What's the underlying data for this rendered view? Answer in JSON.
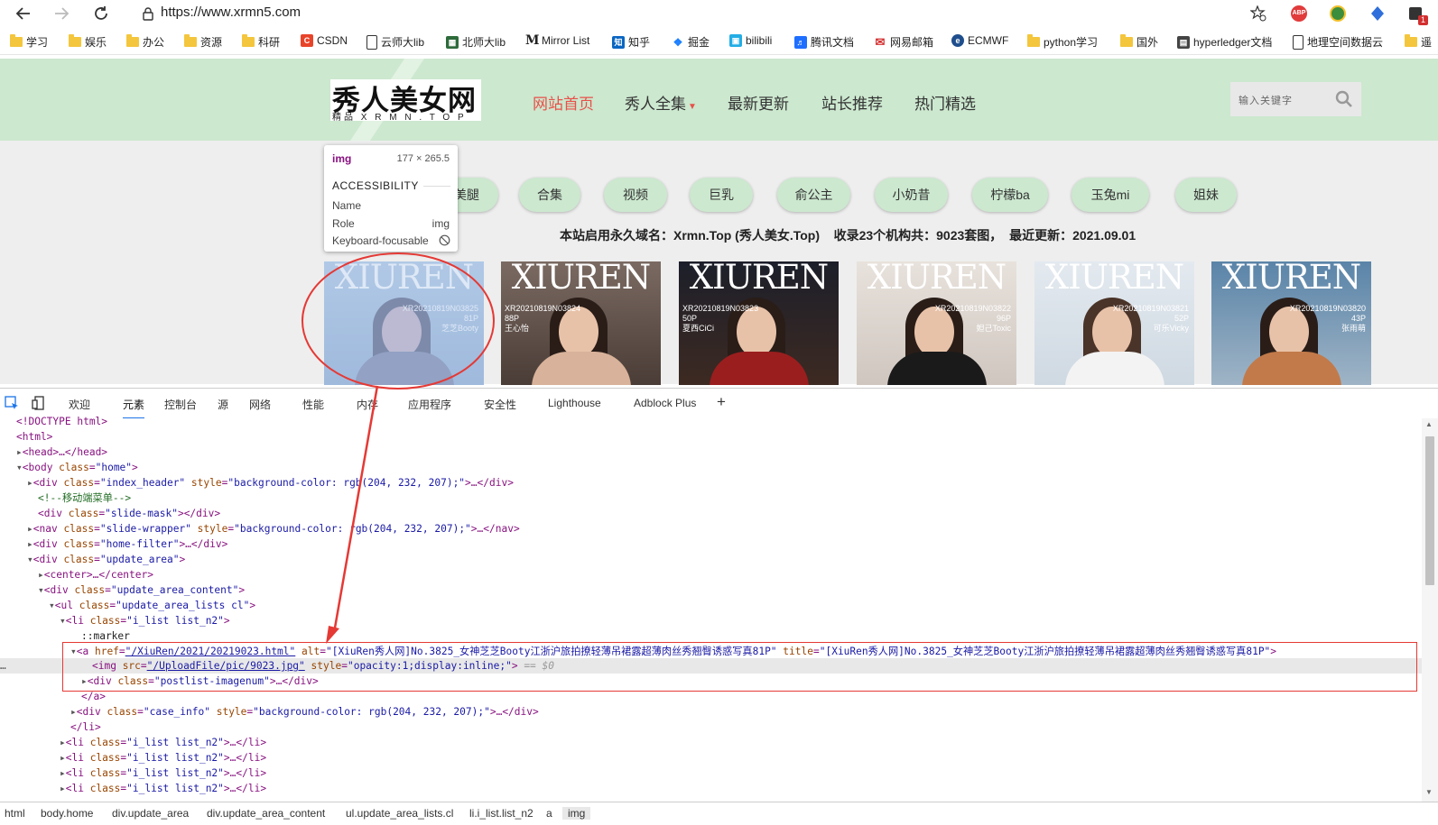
{
  "browser": {
    "url": "https://www.xrmn5.com",
    "bookmarks": [
      "学习",
      "娱乐",
      "办公",
      "资源",
      "科研",
      "CSDN",
      "云师大lib",
      "北师大lib",
      "Mirror List",
      "知乎",
      "掘金",
      "bilibili",
      "腾讯文档",
      "网易邮箱",
      "ECMWF",
      "python学习",
      "国外",
      "hyperledger文档",
      "地理空间数据云",
      "遥"
    ],
    "extension_badge": "1"
  },
  "site": {
    "logo_main": "秀人美女网",
    "logo_sub": "精品 X R M N . T O P",
    "nav": [
      "网站首页",
      "秀人全集",
      "最新更新",
      "站长推荐",
      "热门精选"
    ],
    "search_placeholder": "输入关键字",
    "pills": [
      "美腿",
      "合集",
      "视频",
      "巨乳",
      "俞公主",
      "小奶昔",
      "柠檬ba",
      "玉兔mi",
      "姐妹"
    ],
    "notice": "本站启用永久域名：Xrmn.Top (秀人美女.Top)    收录23个机构共：9023套图，  最近更新：2021.09.01",
    "thumbs": [
      {
        "brand": "XIUREN",
        "code": "XR20210819N03825",
        "count": "81P",
        "name": "芝芝Booty"
      },
      {
        "brand": "XIUREN",
        "code": "XR20210819N03824",
        "count": "88P",
        "name": "王心怡"
      },
      {
        "brand": "XIUREN",
        "code": "XR20210819N03823",
        "count": "50P",
        "name": "夏西CiCi"
      },
      {
        "brand": "XIUREN",
        "code": "XR20210819N03822",
        "count": "96P",
        "name": "妲己Toxic"
      },
      {
        "brand": "XIUREN",
        "code": "XR20210819N03821",
        "count": "52P",
        "name": "可乐Vicky"
      },
      {
        "brand": "XIUREN",
        "code": "XR20210819N03820",
        "count": "43P",
        "name": "张雨萌"
      }
    ]
  },
  "tooltip": {
    "tag": "img",
    "size": "177 × 265.5",
    "section": "ACCESSIBILITY",
    "name_label": "Name",
    "role_label": "Role",
    "role_value": "img",
    "focus_label": "Keyboard-focusable"
  },
  "devtools": {
    "tabs": [
      "欢迎",
      "元素",
      "控制台",
      "源",
      "网络",
      "性能",
      "内存",
      "应用程序",
      "安全性",
      "Lighthouse",
      "Adblock Plus",
      "+"
    ],
    "lines": [
      {
        "tag": "<!DOCTYPE html>"
      },
      {
        "tag": "<html>"
      },
      {
        "tag": "<head>…</head>"
      },
      {
        "tag": "<body ",
        "attr": "class",
        "val": "\"home\"",
        "end": ">"
      },
      {
        "tag": "<div ",
        "attr": "class",
        "val": "\"index_header\"",
        "attr2": "style",
        "val2": "\"background-color: rgb(204, 232, 207);\"",
        "end": ">…</div>"
      },
      {
        "comment": "<!--移动端菜单-->"
      },
      {
        "tag": "<div ",
        "attr": "class",
        "val": "\"slide-mask\"",
        "end": "></div>"
      },
      {
        "tag": "<nav ",
        "attr": "class",
        "val": "\"slide-wrapper\"",
        "attr2": "style",
        "val2": "\"background-color: rgb(204, 232, 207);\"",
        "end": ">…</nav>"
      },
      {
        "tag": "<div ",
        "attr": "class",
        "val": "\"home-filter\"",
        "end": ">…</div>"
      },
      {
        "tag": "<div ",
        "attr": "class",
        "val": "\"update_area\"",
        "end": ">"
      },
      {
        "tag": "<center>…</center>"
      },
      {
        "tag": "<div ",
        "attr": "class",
        "val": "\"update_area_content\"",
        "end": ">"
      },
      {
        "tag": "<ul ",
        "attr": "class",
        "val": "\"update_area_lists cl\"",
        "end": ">"
      },
      {
        "tag": "<li ",
        "attr": "class",
        "val": "\"i_list list_n2\"",
        "end": ">"
      },
      {
        "text": "::marker"
      },
      {
        "tag": "<a ",
        "attr": "href",
        "val": "\"/XiuRen/2021/20219023.html\"",
        "attr2": "alt",
        "val2": "\"[XiuRen秀人网]No.3825_女神芝芝Booty江浙沪旅拍撩轻薄吊裙露超薄肉丝秀翘臀诱惑写真81P\"",
        "attr3": "title",
        "val3": "\"[XiuRen秀人网]No.3825_女神芝芝Booty江浙沪旅拍撩轻薄吊裙露超薄肉丝秀翘臀诱惑写真81P\"",
        "end": ">"
      },
      {
        "tag": "<img ",
        "attr": "src",
        "val": "\"/UploadFile/pic/9023.jpg\"",
        "attr2": "style",
        "val2": "\"opacity:1;display:inline;\"",
        "end": ">",
        "extra": " == $0"
      },
      {
        "tag": "<div ",
        "attr": "class",
        "val": "\"postlist-imagenum\"",
        "end": ">…</div>"
      },
      {
        "tag": "</a>"
      },
      {
        "tag": "<div ",
        "attr": "class",
        "val": "\"case_info\"",
        "attr2": "style",
        "val2": "\"background-color: rgb(204, 232, 207);\"",
        "end": ">…</div>"
      },
      {
        "tag": "</li>"
      },
      {
        "tag": "<li ",
        "attr": "class",
        "val": "\"i_list list_n2\"",
        "end": ">…</li>"
      },
      {
        "tag": "<li ",
        "attr": "class",
        "val": "\"i_list list_n2\"",
        "end": ">…</li>"
      },
      {
        "tag": "<li ",
        "attr": "class",
        "val": "\"i_list list_n2\"",
        "end": ">…</li>"
      },
      {
        "tag": "<li ",
        "attr": "class",
        "val": "\"i_list list_n2\"",
        "end": ">…</li>"
      }
    ],
    "breadcrumbs": [
      "html",
      "body.home",
      "div.update_area",
      "div.update_area_content",
      "ul.update_area_lists.cl",
      "li.i_list.list_n2",
      "a",
      "img"
    ]
  },
  "colors": {
    "site_green": "#cce8cf",
    "nav_active": "#e8514a",
    "annotation_red": "#e53935"
  }
}
